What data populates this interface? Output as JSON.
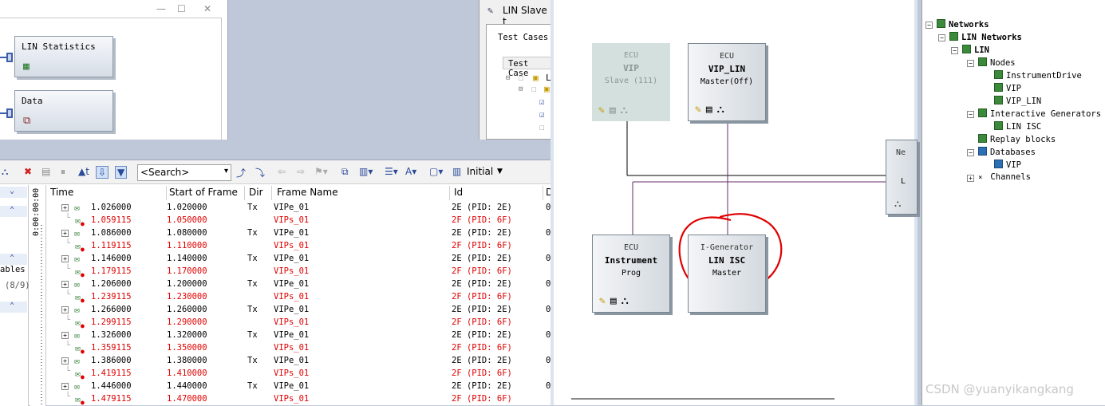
{
  "analysis_window": {
    "blocks": [
      {
        "label": "LIN Statistics",
        "icon": "statistics-icon"
      },
      {
        "label": "Data",
        "icon": "data-window-icon"
      }
    ]
  },
  "test_window": {
    "title": "LIN Slave t",
    "tab": "Test Cases",
    "column": "Test Case",
    "first_node": "L"
  },
  "left_pane": {
    "partial_label": "ables",
    "partial_count": "(8/9)"
  },
  "trace": {
    "toolbar": {
      "search_placeholder": "<Search>",
      "layout_label": "Initial"
    },
    "time_axis": "0:00:00:00",
    "columns": [
      "Time",
      "Start of Frame",
      "Dir",
      "Frame Name",
      "Id",
      "D"
    ],
    "rows": [
      {
        "time": "1.026000",
        "sof": "1.020000",
        "dir": "Tx",
        "name": "VIPe_01",
        "id": "2E (PID: 2E)",
        "d": "0",
        "error": false
      },
      {
        "time": "1.059115",
        "sof": "1.050000",
        "dir": "",
        "name": "VIPs_01",
        "id": "2F (PID: 6F)",
        "d": "",
        "error": true
      },
      {
        "time": "1.086000",
        "sof": "1.080000",
        "dir": "Tx",
        "name": "VIPe_01",
        "id": "2E (PID: 2E)",
        "d": "0",
        "error": false
      },
      {
        "time": "1.119115",
        "sof": "1.110000",
        "dir": "",
        "name": "VIPs_01",
        "id": "2F (PID: 6F)",
        "d": "",
        "error": true
      },
      {
        "time": "1.146000",
        "sof": "1.140000",
        "dir": "Tx",
        "name": "VIPe_01",
        "id": "2E (PID: 2E)",
        "d": "0",
        "error": false
      },
      {
        "time": "1.179115",
        "sof": "1.170000",
        "dir": "",
        "name": "VIPs_01",
        "id": "2F (PID: 6F)",
        "d": "",
        "error": true
      },
      {
        "time": "1.206000",
        "sof": "1.200000",
        "dir": "Tx",
        "name": "VIPe_01",
        "id": "2E (PID: 2E)",
        "d": "0",
        "error": false
      },
      {
        "time": "1.239115",
        "sof": "1.230000",
        "dir": "",
        "name": "VIPs_01",
        "id": "2F (PID: 6F)",
        "d": "",
        "error": true
      },
      {
        "time": "1.266000",
        "sof": "1.260000",
        "dir": "Tx",
        "name": "VIPe_01",
        "id": "2E (PID: 2E)",
        "d": "0",
        "error": false
      },
      {
        "time": "1.299115",
        "sof": "1.290000",
        "dir": "",
        "name": "VIPs_01",
        "id": "2F (PID: 6F)",
        "d": "",
        "error": true
      },
      {
        "time": "1.326000",
        "sof": "1.320000",
        "dir": "Tx",
        "name": "VIPe_01",
        "id": "2E (PID: 2E)",
        "d": "0",
        "error": false
      },
      {
        "time": "1.359115",
        "sof": "1.350000",
        "dir": "",
        "name": "VIPs_01",
        "id": "2F (PID: 6F)",
        "d": "",
        "error": true
      },
      {
        "time": "1.386000",
        "sof": "1.380000",
        "dir": "Tx",
        "name": "VIPe_01",
        "id": "2E (PID: 2E)",
        "d": "0",
        "error": false
      },
      {
        "time": "1.419115",
        "sof": "1.410000",
        "dir": "",
        "name": "VIPs_01",
        "id": "2F (PID: 6F)",
        "d": "",
        "error": true
      },
      {
        "time": "1.446000",
        "sof": "1.440000",
        "dir": "Tx",
        "name": "VIPe_01",
        "id": "2E (PID: 2E)",
        "d": "0",
        "error": false
      },
      {
        "time": "1.479115",
        "sof": "1.470000",
        "dir": "",
        "name": "VIPs_01",
        "id": "2F (PID: 6F)",
        "d": "",
        "error": true
      }
    ]
  },
  "network": {
    "ecus": [
      {
        "type": "ECU",
        "name": "VIP",
        "mode": "Slave (111)",
        "disabled": true
      },
      {
        "type": "ECU",
        "name": "VIP_LIN",
        "mode": "Master(Off)",
        "disabled": false
      },
      {
        "type": "ECU",
        "name": "Instrument",
        "mode": "Prog",
        "disabled": false
      },
      {
        "type": "I-Generator",
        "name": "LIN ISC",
        "mode": "Master",
        "disabled": false
      }
    ],
    "partial_node": {
      "line1": "Ne",
      "line2": "L"
    },
    "bus_color": "#6a2a6a",
    "annotation_color": "#e00000"
  },
  "tree": {
    "items": [
      {
        "label": "Networks",
        "bold": true
      },
      {
        "label": "LIN Networks",
        "bold": true
      },
      {
        "label": "LIN",
        "bold": true
      },
      {
        "label": "Nodes",
        "bold": false
      },
      {
        "label": "InstrumentDrive",
        "bold": false
      },
      {
        "label": "VIP",
        "bold": false
      },
      {
        "label": "VIP_LIN",
        "bold": false
      },
      {
        "label": "Interactive Generators",
        "bold": false
      },
      {
        "label": "LIN ISC",
        "bold": false
      },
      {
        "label": "Replay blocks",
        "bold": false
      },
      {
        "label": "Databases",
        "bold": false
      },
      {
        "label": "VIP",
        "bold": false
      },
      {
        "label": "Channels",
        "bold": false
      }
    ]
  },
  "watermark": "CSDN @yuanyikangkang"
}
